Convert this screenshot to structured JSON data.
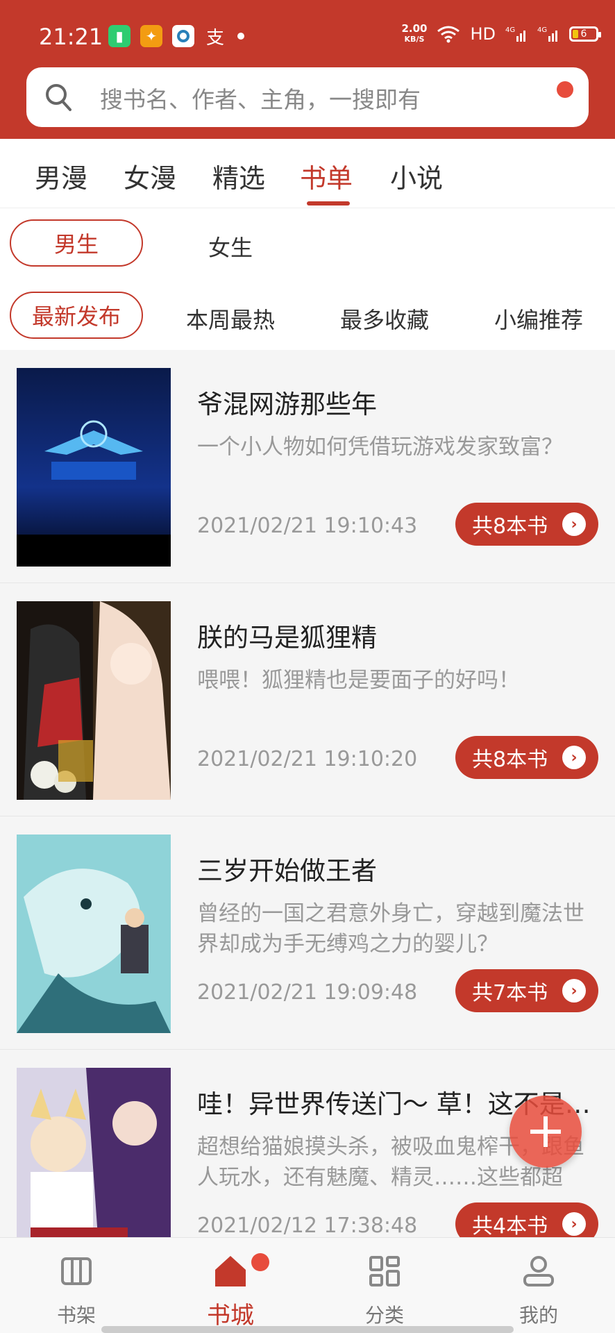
{
  "status": {
    "time": "21:21",
    "netspeed_value": "2.00",
    "netspeed_unit": "KB/S",
    "hd": "HD",
    "battery": "6"
  },
  "search": {
    "placeholder": "搜书名、作者、主角，一搜即有"
  },
  "tabs": [
    "男漫",
    "女漫",
    "精选",
    "书单",
    "小说"
  ],
  "active_tab": "书单",
  "gender": {
    "male": "男生",
    "female": "女生",
    "selected": "男生"
  },
  "sort": {
    "options": [
      "最新发布",
      "本周最热",
      "最多收藏",
      "小编推荐"
    ],
    "selected": "最新发布"
  },
  "lists": [
    {
      "title": "爷混网游那些年",
      "desc": "一个小人物如何凭借玩游戏发家致富？",
      "date": "2021/02/21 19:10:43",
      "count": "共8本书"
    },
    {
      "title": "朕的马是狐狸精",
      "desc": "喂喂！狐狸精也是要面子的好吗！",
      "date": "2021/02/21 19:10:20",
      "count": "共8本书"
    },
    {
      "title": "三岁开始做王者",
      "desc": "曾经的一国之君意外身亡，穿越到魔法世界却成为手无缚鸡之力的婴儿？",
      "date": "2021/02/21 19:09:48",
      "count": "共7本书"
    },
    {
      "title": "哇！异世界传送门～ 草！这不是…",
      "desc": "超想给猫娘摸头杀，被吸血鬼榨干，跟鱼人玩水，还有魅魔、精灵……这些都超想…",
      "date": "2021/02/12 17:38:48",
      "count": "共4本书"
    }
  ],
  "bottom_nav": [
    "书架",
    "书城",
    "分类",
    "我的"
  ],
  "active_bottom": "书城",
  "colors": {
    "brand": "#c3392b",
    "accent_dot": "#e74c3c"
  }
}
